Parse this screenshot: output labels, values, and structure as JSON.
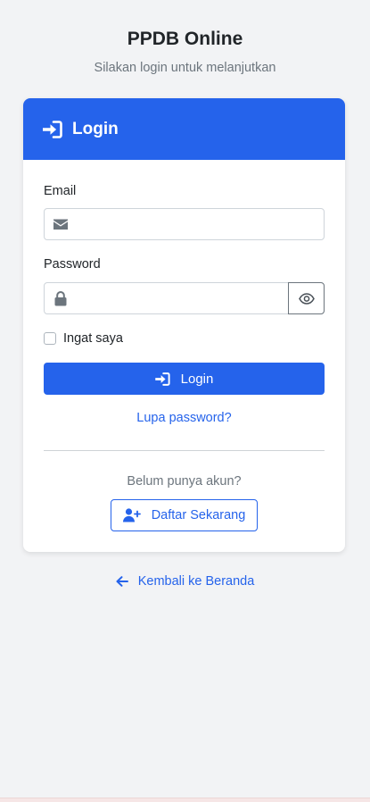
{
  "header": {
    "title": "PPDB Online",
    "subtitle": "Silakan login untuk melanjutkan"
  },
  "card": {
    "title": "Login",
    "title_icon": "sign-in-icon"
  },
  "form": {
    "email_label": "Email",
    "email_value": "",
    "email_icon": "envelope-icon",
    "password_label": "Password",
    "password_value": "",
    "password_icon": "lock-icon",
    "toggle_icon": "eye-icon",
    "remember_label": "Ingat saya",
    "remember_checked": false,
    "submit_label": "Login",
    "submit_icon": "sign-in-icon",
    "forgot_label": "Lupa password?"
  },
  "register": {
    "prompt": "Belum punya akun?",
    "button_label": "Daftar Sekarang",
    "button_icon": "user-plus-icon"
  },
  "footer": {
    "back_label": "Kembali ke Beranda",
    "back_icon": "arrow-left-icon"
  },
  "colors": {
    "primary": "#2563eb",
    "background": "#f2f3f5",
    "muted": "#6c757d"
  }
}
